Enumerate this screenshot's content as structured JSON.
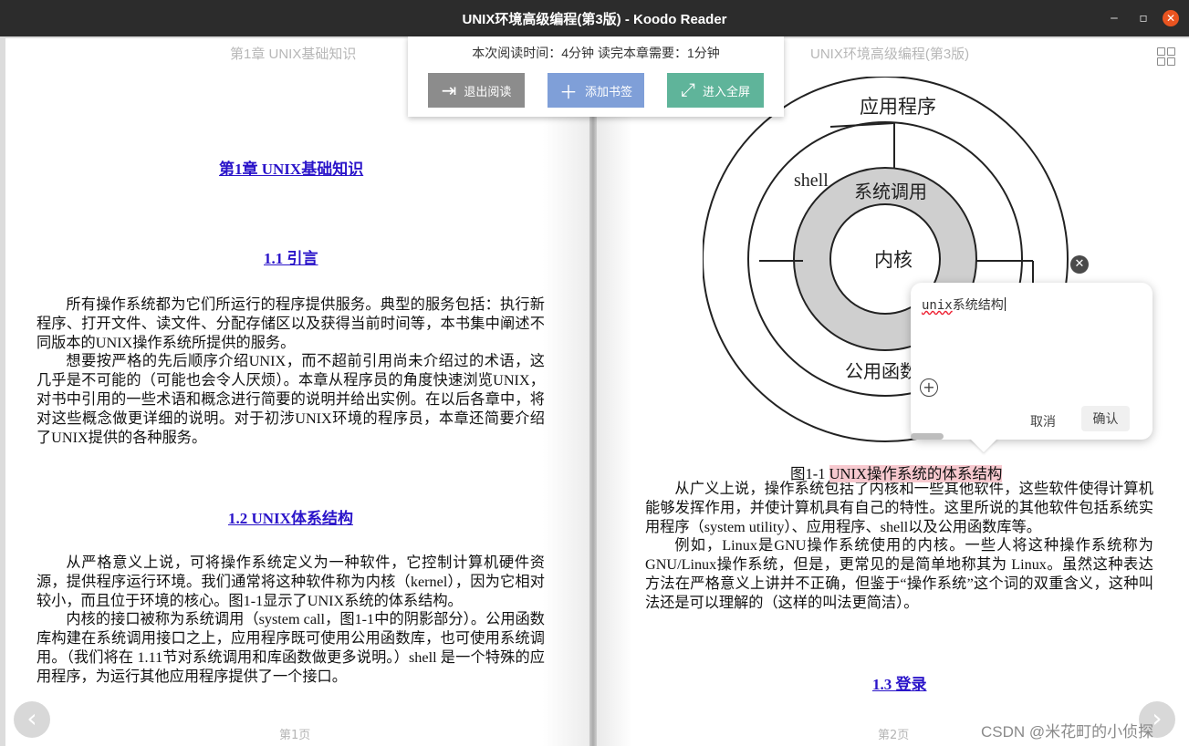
{
  "window": {
    "title": "UNIX环境高级编程(第3版) - Koodo Reader"
  },
  "top_panel": {
    "reading_info": "本次阅读时间：4分钟   读完本章需要：1分钟",
    "buttons": {
      "exit": "退出阅读",
      "bookmark": "添加书签",
      "fullscreen": "进入全屏"
    }
  },
  "left_page": {
    "header": "第1章 UNIX基础知识",
    "chapter_title": "第1章 UNIX基础知识",
    "section_1_1": "1.1 引言",
    "para1": "所有操作系统都为它们所运行的程序提供服务。典型的服务包括：执行新程序、打开文件、读文件、分配存储区以及获得当前时间等，本书集中阐述不同版本的UNIX操作系统所提供的服务。",
    "para2": "想要按严格的先后顺序介绍UNIX，而不超前引用尚未介绍过的术语，这几乎是不可能的（可能也会令人厌烦）。本章从程序员的角度快速浏览UNIX，对书中引用的一些术语和概念进行简要的说明并给出实例。在以后各章中，将对这些概念做更详细的说明。对于初涉UNIX环境的程序员，本章还简要介绍了UNIX提供的各种服务。",
    "section_1_2": "1.2 UNIX体系结构",
    "para3": "从严格意义上说，可将操作系统定义为一种软件，它控制计算机硬件资源，提供程序运行环境。我们通常将这种软件称为内核（kernel），因为它相对较小，而且位于环境的核心。图1-1显示了UNIX系统的体系结构。",
    "para4": "内核的接口被称为系统调用（system call，图1-1中的阴影部分）。公用函数库构建在系统调用接口之上，应用程序既可使用公用函数库，也可使用系统调用。（我们将在 1.11节对系统调用和库函数做更多说明。）shell 是一个特殊的应用程序，为运行其他应用程序提供了一个接口。",
    "page_number": "第1页"
  },
  "right_page": {
    "header": "UNIX环境高级编程(第3版)",
    "diagram": {
      "outer": "应用程序",
      "shell": "shell",
      "syscall": "系统调用",
      "kernel": "内核",
      "library": "公用函数"
    },
    "caption_prefix": "图1-1 ",
    "caption_highlight": "UNIX操作系统的体系结构",
    "para1": "从广义上说，操作系统包括了内核和一些其他软件，这些软件使得计算机能够发挥作用，并使计算机具有自己的特性。这里所说的其他软件包括系统实用程序（system utility）、应用程序、shell以及公用函数库等。",
    "para2": "例如，Linux是GNU操作系统使用的内核。一些人将这种操作系统称为GNU/Linux操作系统，但是，更常见的是简单地称其为 Linux。虽然这种表达方法在严格意义上讲并不正确，但鉴于“操作系统”这个词的双重含义，这种叫法还是可以理解的（这样的叫法更简洁）。",
    "section_1_3": "1.3 登录",
    "page_number": "第2页"
  },
  "note_popup": {
    "text_mono": "unix",
    "text_rest": "系统结构",
    "cancel": "取消",
    "confirm": "确认"
  },
  "watermark": "CSDN @米花町的小侦探",
  "icons": {
    "exit": "exit-icon",
    "bookmark": "plus-icon",
    "fullscreen": "expand-icon",
    "grid": "grid-icon",
    "close": "close-icon"
  },
  "colors": {
    "link": "#2a14c9",
    "highlight": "#f7c9cf",
    "btn_exit": "#8c8c8c",
    "btn_bookmark": "#7f9fd8",
    "btn_fullscreen": "#5fb49a"
  }
}
